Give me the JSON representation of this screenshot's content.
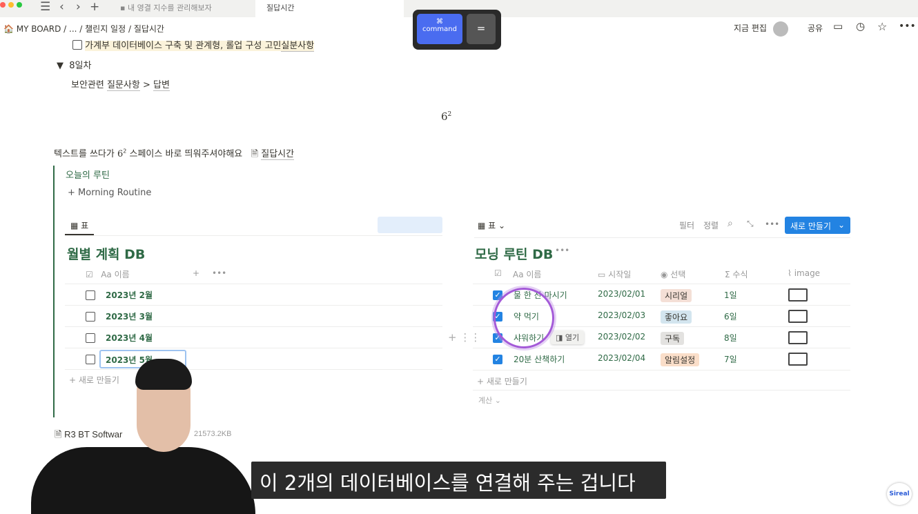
{
  "window": {
    "tabs": [
      {
        "label": "내 영결 지수를 관리해보자"
      },
      {
        "label": "질답시간"
      }
    ]
  },
  "breadcrumb": [
    "MY BOARD",
    "...",
    "챌린지 일정",
    "질답시간"
  ],
  "topbar": {
    "editing": "지금 편집",
    "share": "공유"
  },
  "keys": {
    "cmd_symbol": "⌘",
    "cmd": "command",
    "eq": "="
  },
  "content": {
    "todo": "가계부 데이터베이스 구축 및 관계형, 롤업 구성 고민",
    "todo_link": "실분사항",
    "toggle": "8일차",
    "security": "보안관련",
    "security_link1": "질문사항",
    "security_sep": ">",
    "security_link2": "답변",
    "math": "6",
    "math_exp": "2",
    "tip_a": "텍스트를 쓰다가",
    "tip_b": "스페이스 바로 띄워주셔야해요",
    "tip_link": "질답시간",
    "routine_title": "오늘의 루틴",
    "morning": "Morning Routine"
  },
  "left_db": {
    "view": "표",
    "title": "월별 계획 DB",
    "col_name": "Aa 이름",
    "rows": [
      "2023년 2월",
      "2023년 3월",
      "2023년 4월",
      "2023년 5월"
    ],
    "new": "새로 만들기"
  },
  "right_db": {
    "view": "표",
    "filter": "필터",
    "sort": "정렬",
    "new_button": "새로 만들기",
    "title": "모닝 루틴 DB",
    "columns": [
      "Aa 이름",
      "시작일",
      "선택",
      "수식",
      "image"
    ],
    "rows": [
      {
        "name": "물 한 잔 마시기",
        "date": "2023/02/01",
        "tag": "시리얼",
        "tag_color": "#f4dfd6",
        "formula": "1일"
      },
      {
        "name": "약 먹기",
        "date": "2023/02/03",
        "tag": "좋아요",
        "tag_color": "#d3e5ef",
        "formula": "6일"
      },
      {
        "name": "샤워하기",
        "date": "2023/02/02",
        "tag": "구독",
        "tag_color": "#e3e2e0",
        "formula": "8일"
      },
      {
        "name": "20분 산책하기",
        "date": "2023/02/04",
        "tag": "알림설정",
        "tag_color": "#fadec9",
        "formula": "7일"
      }
    ],
    "open": "열기",
    "new": "새로 만들기",
    "calc": "계산"
  },
  "files": [
    {
      "name": "R3 BT Softwar",
      "size": "21573.2KB"
    }
  ],
  "subtitle": "이 2개의 데이터베이스를 연결해 주는 겁니다",
  "logo": "Sireal"
}
